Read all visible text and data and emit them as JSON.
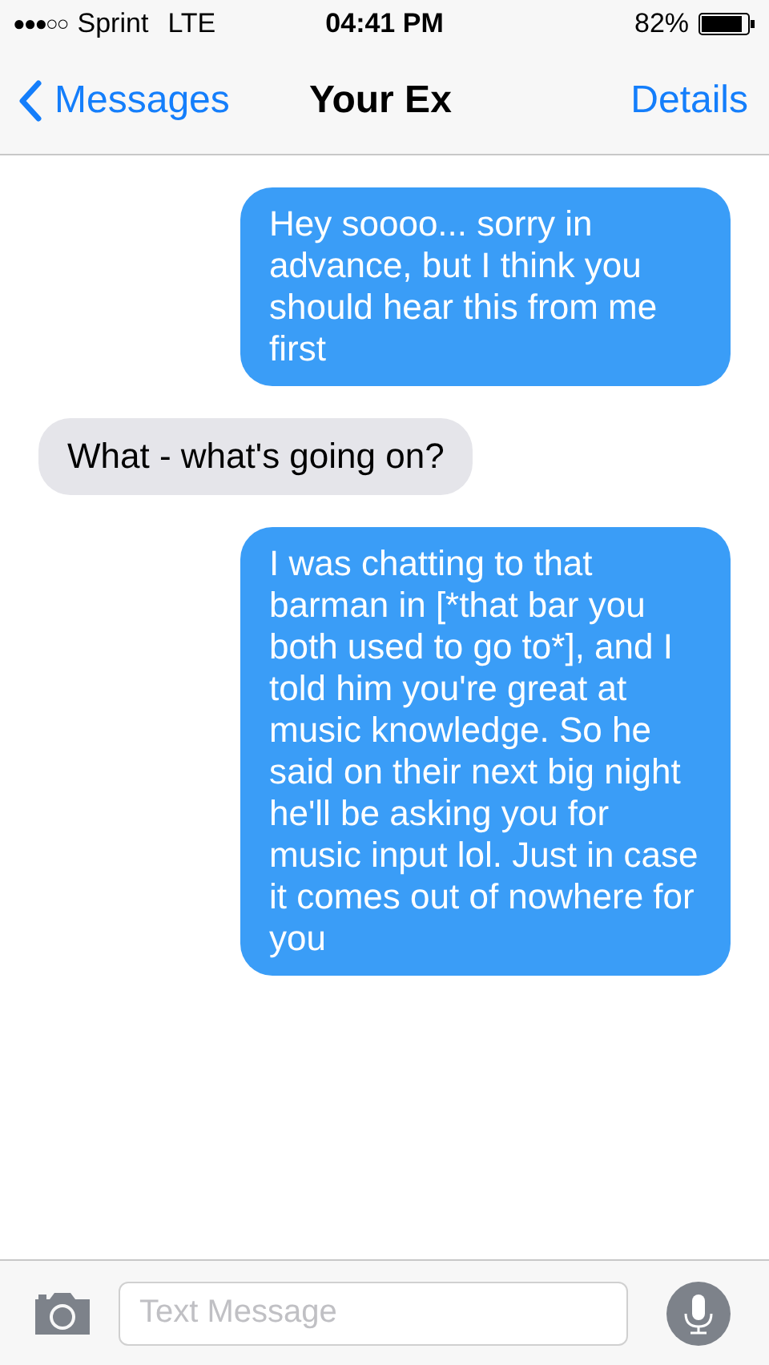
{
  "status_bar": {
    "signal": "●●●○○",
    "carrier": "Sprint",
    "network": "LTE",
    "time": "04:41 PM",
    "battery": "82%"
  },
  "nav": {
    "back": "Messages",
    "title": "Your Ex",
    "action": "Details"
  },
  "messages": [
    {
      "kind": "sent",
      "text": "Hey soooo... sorry in advance, but I think you should hear this from me first"
    },
    {
      "kind": "received",
      "text": "What - what's going on?"
    },
    {
      "kind": "sent",
      "text": "I was chatting to that barman in [*that bar you both used to go to*], and I told him you're great at music knowledge. So he said on their next big night he'll be asking you for music input lol. Just in case it comes out of nowhere for you"
    }
  ],
  "composer": {
    "placeholder": "Text Message"
  }
}
